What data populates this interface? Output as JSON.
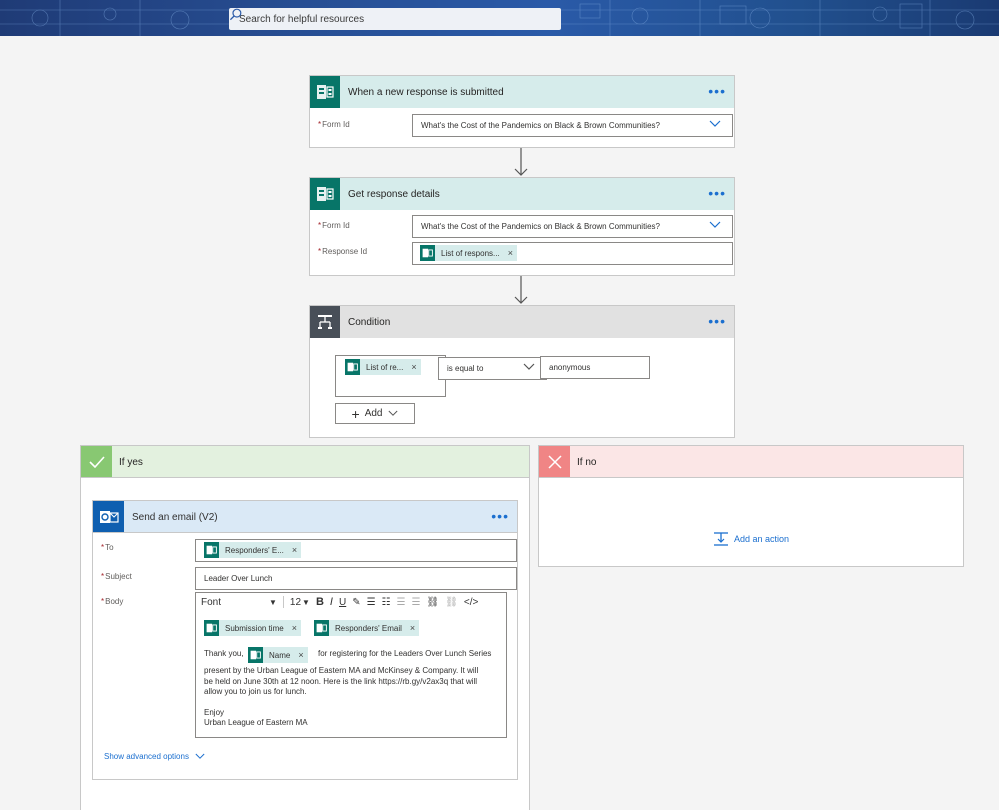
{
  "header": {
    "search_placeholder": "Search for helpful resources"
  },
  "trigger": {
    "title": "When a new response is submitted",
    "form_id_label": "Form Id",
    "form_id_value": "What's the Cost of the Pandemics on Black & Brown Communities?"
  },
  "get_details": {
    "title": "Get response details",
    "form_id_label": "Form Id",
    "form_id_value": "What's the Cost of the Pandemics on Black & Brown Communities?",
    "response_id_label": "Response Id",
    "response_id_token": "List of respons..."
  },
  "condition": {
    "title": "Condition",
    "left_token": "List of re...",
    "operator": "is equal to",
    "value": "anonymous",
    "add_label": "Add"
  },
  "if_yes": {
    "label": "If yes"
  },
  "if_no": {
    "label": "If no",
    "add_action_label": "Add an action"
  },
  "email": {
    "title": "Send an email (V2)",
    "to_label": "To",
    "to_token": "Responders' E...",
    "subject_label": "Subject",
    "subject_value": "Leader Over Lunch",
    "body_label": "Body",
    "toolbar": {
      "font": "Font",
      "size": "12"
    },
    "body_tokens": {
      "submission_time": "Submission time",
      "responders_email": "Responders' Email",
      "name": "Name"
    },
    "body_text": {
      "line1_before": "Thank you,",
      "line1_after": "for registering for the Leaders Over Lunch Series",
      "line2": "present by the Urban League of Eastern MA and McKinsey & Company. It will",
      "line3": "be held on June 30th at 12 noon. Here is the link https://rb.gy/v2ax3q that will",
      "line4": "allow you to join us for lunch.",
      "line5": "Enjoy",
      "line6": "Urban League of Eastern MA"
    },
    "advanced_label": "Show advanced options"
  },
  "colors": {
    "forms_teal": "#077568",
    "forms_head_bg": "#d6eceb",
    "condition_head_bg": "#e1e1e1",
    "yes_green": "#88c872",
    "no_red": "#f08585",
    "outlook_blue": "#0f5fb0",
    "link_blue": "#1b6fcf"
  },
  "icons": {
    "forms": "forms-icon",
    "condition": "condition-icon",
    "outlook": "outlook-icon",
    "check": "check-icon",
    "close": "x-icon",
    "more": "more-dots-icon"
  }
}
